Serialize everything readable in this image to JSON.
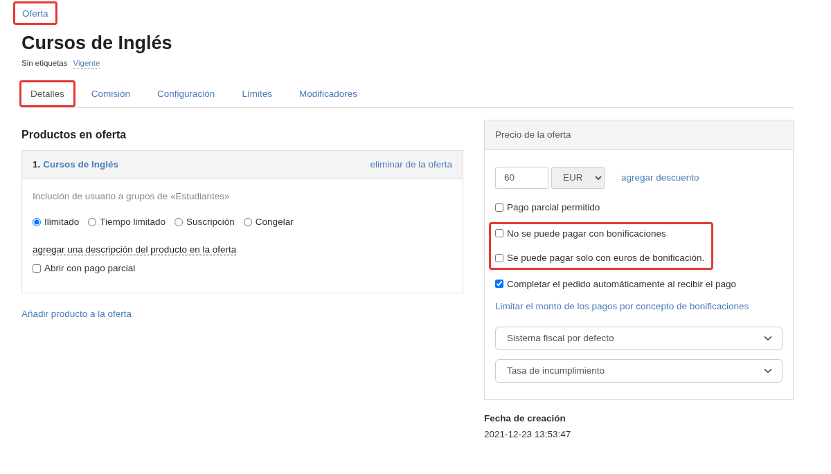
{
  "breadcrumb": {
    "label": "Oferta",
    "highlighted": true
  },
  "title": "Cursos de Inglés",
  "tags": {
    "label": "Sin etiquetas",
    "status": "Vigente"
  },
  "tabs": [
    {
      "label": "Detalles",
      "selected": true,
      "highlighted": true
    },
    {
      "label": "Comisión",
      "selected": false,
      "highlighted": false
    },
    {
      "label": "Configuración",
      "selected": false,
      "highlighted": false
    },
    {
      "label": "Límites",
      "selected": false,
      "highlighted": false
    },
    {
      "label": "Modificadores",
      "selected": false,
      "highlighted": false
    }
  ],
  "products": {
    "heading": "Productos en oferta",
    "items": [
      {
        "number": "1.",
        "name": "Cursos de Inglés",
        "remove": "eliminar de la oferta",
        "description": "Inclución de usuario a grupos de «Estudiantes»",
        "access": [
          {
            "label": "Ilimitado",
            "selected": true
          },
          {
            "label": "Tiempo limitado",
            "selected": false
          },
          {
            "label": "Suscripción",
            "selected": false
          },
          {
            "label": "Congelar",
            "selected": false
          }
        ],
        "add_description": "agregar una descripción del producto en la oferta",
        "partial": {
          "label": "Abrir con pago parcial",
          "checked": false
        }
      }
    ],
    "add_product": "Añadir producto a la oferta"
  },
  "price": {
    "heading": "Precio de la oferta",
    "amount": "60",
    "currency": "EUR",
    "discount": "agregar descuento",
    "options": [
      {
        "label": "Pago parcial permitido",
        "checked": false,
        "highlighted": false
      },
      {
        "label": "No se puede pagar con bonificaciones",
        "checked": false,
        "highlighted": true
      },
      {
        "label": "Se puede pagar solo con euros de bonificación.",
        "checked": false,
        "highlighted": true
      },
      {
        "label": "Completar el pedido automáticamente al recibir el pago",
        "checked": true,
        "highlighted": false
      }
    ],
    "limit_link": "Limitar el monto de los pagos por concepto de bonificaciones",
    "selects": [
      "Sistema fiscal por defecto",
      "Tasa de incumplimiento"
    ]
  },
  "created": {
    "label": "Fecha de creación",
    "value": "2021-12-23 13:53:47"
  }
}
